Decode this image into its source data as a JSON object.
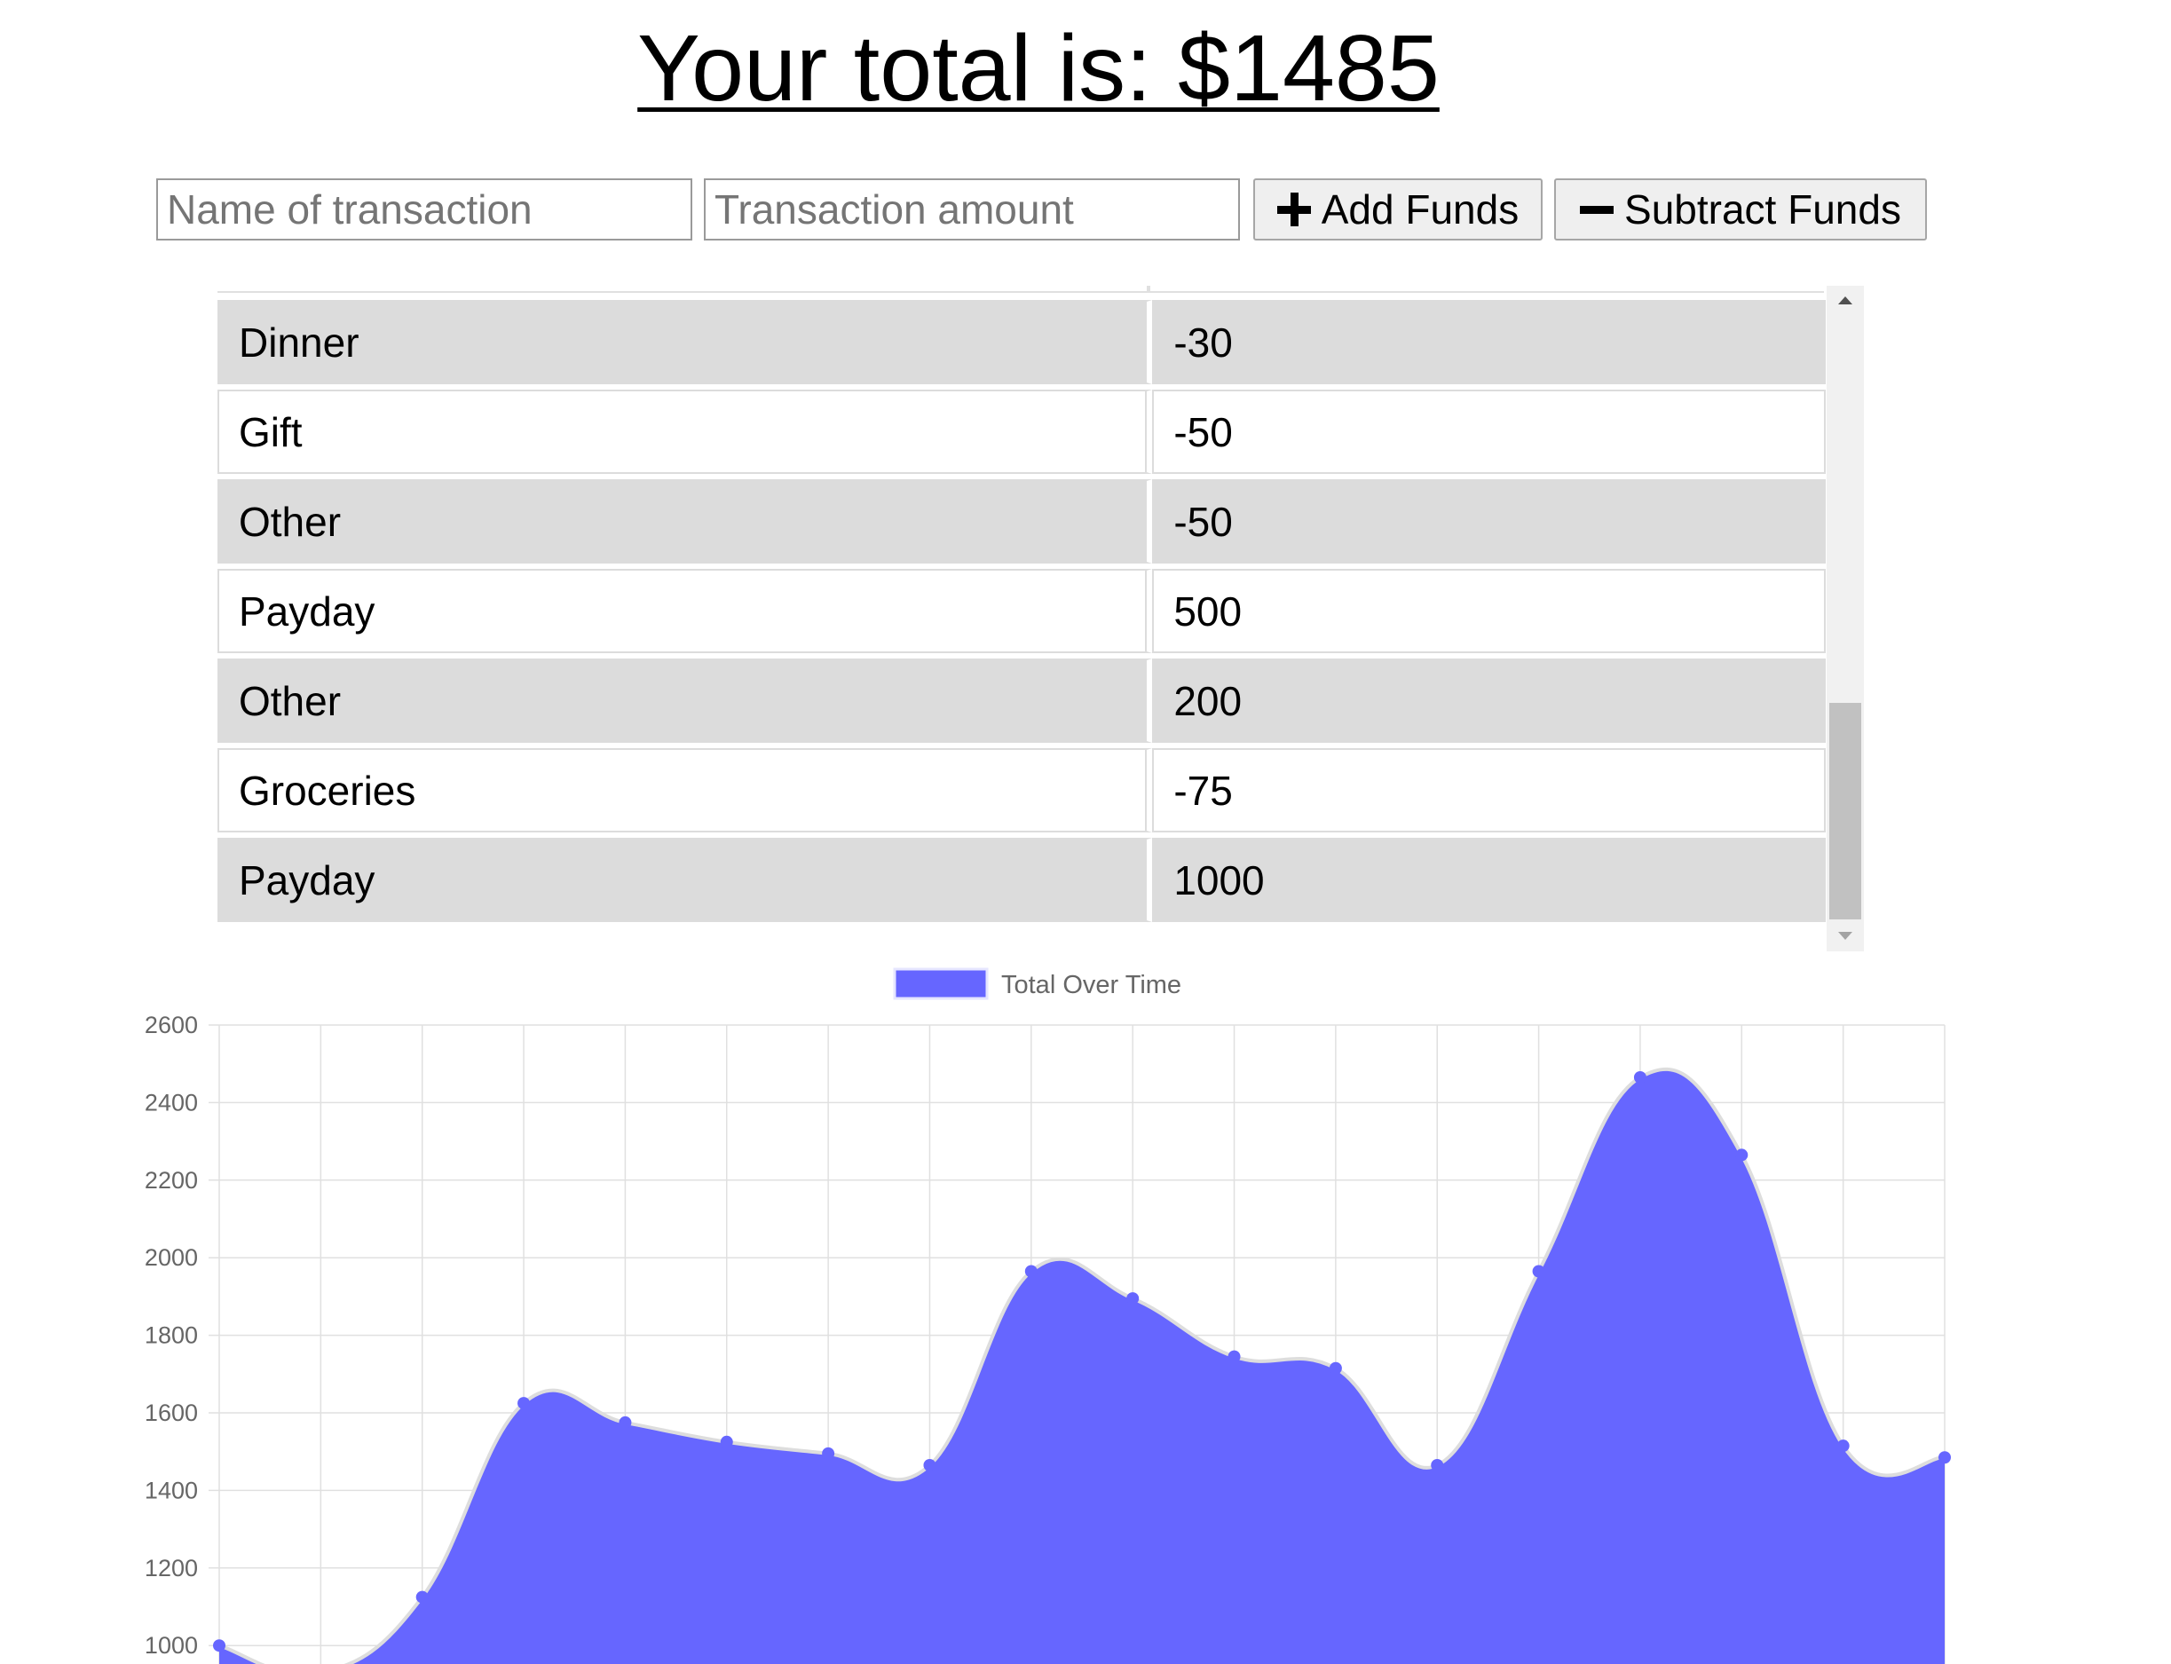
{
  "header": {
    "title": "Your total is: $1485"
  },
  "form": {
    "name_placeholder": "Name of transaction",
    "amount_placeholder": "Transaction amount",
    "add_label": "Add Funds",
    "subtract_label": "Subtract Funds",
    "add_icon": "plus-icon",
    "subtract_icon": "minus-icon"
  },
  "transactions": [
    {
      "name": "Dinner",
      "amount": "-30"
    },
    {
      "name": "Gift",
      "amount": "-50"
    },
    {
      "name": "Other",
      "amount": "-50"
    },
    {
      "name": "Payday",
      "amount": "500"
    },
    {
      "name": "Other",
      "amount": "200"
    },
    {
      "name": "Groceries",
      "amount": "-75"
    },
    {
      "name": "Payday",
      "amount": "1000"
    }
  ],
  "scrollbar": {
    "position": 0.62,
    "visible_fraction": 0.36
  },
  "colors": {
    "fill": "#6666ff",
    "point": "#6666ff",
    "line": "#dddddd",
    "grid": "#e0e0e0",
    "row_shade": "#dcdcdc"
  },
  "chart_data": {
    "type": "area",
    "legend": "Total Over Time",
    "legend_position": "top-center",
    "grid": true,
    "ylim": [
      1000,
      2600
    ],
    "yticks": [
      1000,
      1200,
      1400,
      1600,
      1800,
      2000,
      2200,
      2400,
      2600
    ],
    "series": [
      {
        "name": "Total Over Time",
        "values": [
          1000,
          930,
          1125,
          1625,
          1575,
          1525,
          1495,
          1465,
          1965,
          1895,
          1745,
          1715,
          1465,
          1965,
          2465,
          2265,
          1515,
          1485
        ]
      }
    ]
  }
}
